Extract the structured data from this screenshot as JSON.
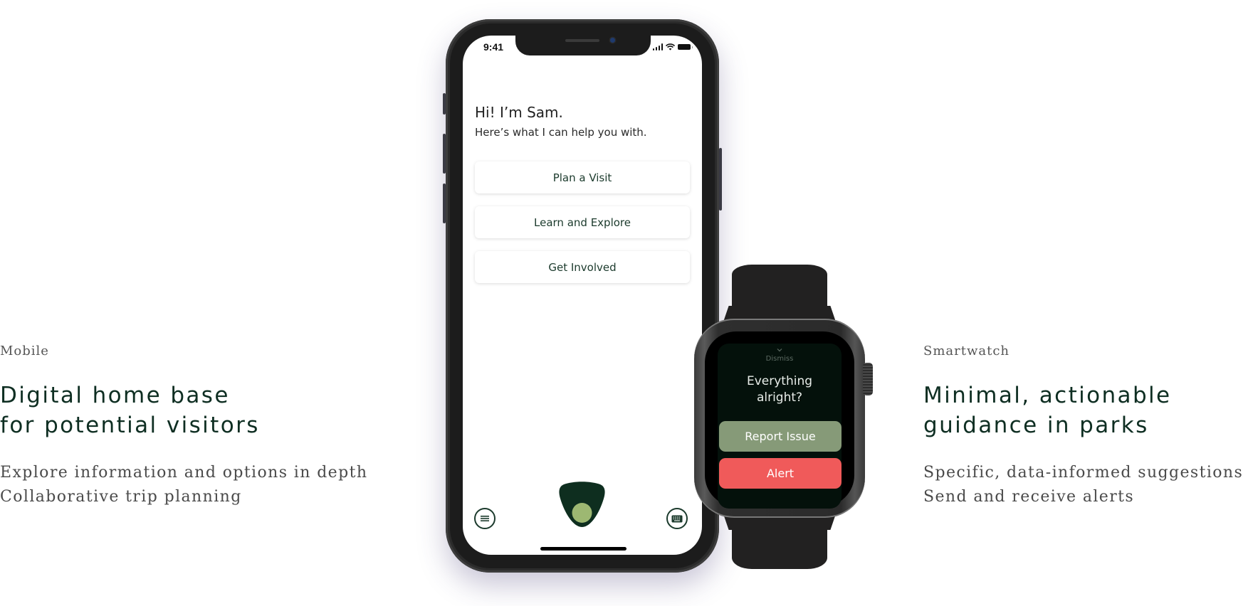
{
  "colors": {
    "brand_dark_green": "#0e2e22",
    "avatar_light_green": "#9db872",
    "report_button": "#869a78",
    "alert_button": "#f05a5a",
    "watch_screen_bg": "#04110b"
  },
  "mobile_section": {
    "eyebrow": "Mobile",
    "headline_lines": [
      "Digital home base",
      "for potential visitors"
    ],
    "body_lines": [
      "Explore information and options in depth",
      "Collaborative trip planning"
    ]
  },
  "smartwatch_section": {
    "eyebrow": "Smartwatch",
    "headline_lines": [
      "Minimal, actionable",
      "guidance in parks"
    ],
    "body_lines": [
      "Specific, data-informed suggestions",
      "Send and receive alerts"
    ]
  },
  "phone": {
    "status_bar": {
      "time": "9:41",
      "icons": [
        "cellular-signal-icon",
        "wifi-icon",
        "battery-icon"
      ]
    },
    "greeting": "Hi! I’m Sam.",
    "subtitle": "Here’s what I can help you with.",
    "options": [
      {
        "label": "Plan a Visit"
      },
      {
        "label": "Learn and Explore"
      },
      {
        "label": "Get Involved"
      }
    ],
    "bottom_bar": {
      "left_icon": "menu-icon",
      "center_icon": "assistant-avatar-icon",
      "right_icon": "keyboard-icon"
    }
  },
  "watch": {
    "dismiss_label": "Dismiss",
    "question_lines": [
      "Everything",
      "alright?"
    ],
    "buttons": [
      {
        "label": "Report Issue"
      },
      {
        "label": "Alert"
      }
    ]
  }
}
